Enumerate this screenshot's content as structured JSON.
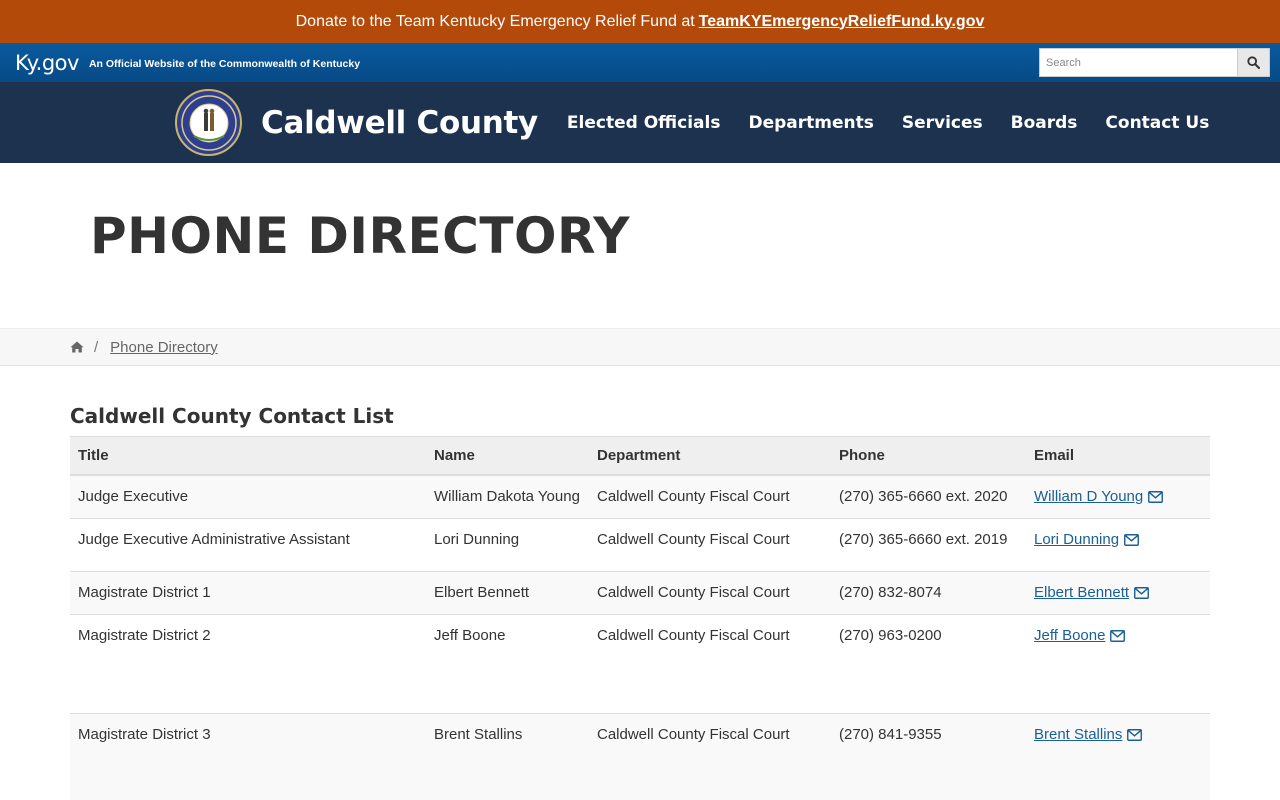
{
  "donate": {
    "text": "Donate to the Team Kentucky Emergency Relief Fund at",
    "link": "TeamKYEmergencyReliefFund.ky.gov"
  },
  "kygov": {
    "logo": "Ky.gov",
    "tagline": "An Official Website of the Commonwealth of Kentucky",
    "search_placeholder": "Search"
  },
  "header": {
    "county_name": "Caldwell County",
    "nav": [
      "Elected Officials",
      "Departments",
      "Services",
      "Boards",
      "Contact Us"
    ]
  },
  "page": {
    "title": "PHONE DIRECTORY"
  },
  "breadcrumb": {
    "separator": "/",
    "current": "Phone Directory"
  },
  "directory": {
    "title": "Caldwell County Contact List",
    "columns": [
      "Title",
      "Name",
      "Department",
      "Phone",
      "Email"
    ],
    "rows": [
      {
        "title": "Judge Executive",
        "name": "William Dakota Young",
        "department": "Caldwell County Fiscal Court",
        "phone": "(270) 365-6660 ext. 2020",
        "email": "William D Young"
      },
      {
        "title": "Judge Executive Administrative Assistant",
        "name": "Lori Dunning",
        "department": "Caldwell County Fiscal Court",
        "phone": "(270) 365-6660 ext. 2019",
        "email": "Lori Dunning"
      },
      {
        "title": "Magistrate District 1",
        "name": "Elbert Bennett",
        "department": "Caldwell County Fiscal Court",
        "phone": "(270) 832-8074",
        "email": "Elbert Bennett"
      },
      {
        "title": "Magistrate District 2",
        "name": "Jeff Boone",
        "department": "Caldwell County Fiscal Court",
        "phone": "(270) 963-0200",
        "email": "Jeff Boone"
      },
      {
        "title": "Magistrate District 3",
        "name": "Brent Stallins",
        "department": "Caldwell County Fiscal Court",
        "phone": "(270) 841-9355",
        "email": "Brent Stallins"
      }
    ]
  },
  "colors": {
    "donate_bg": "#b44a0a",
    "kygov_bg": "#0a5a9e",
    "nav_bg": "#1c324f",
    "link": "#1a5f95"
  }
}
